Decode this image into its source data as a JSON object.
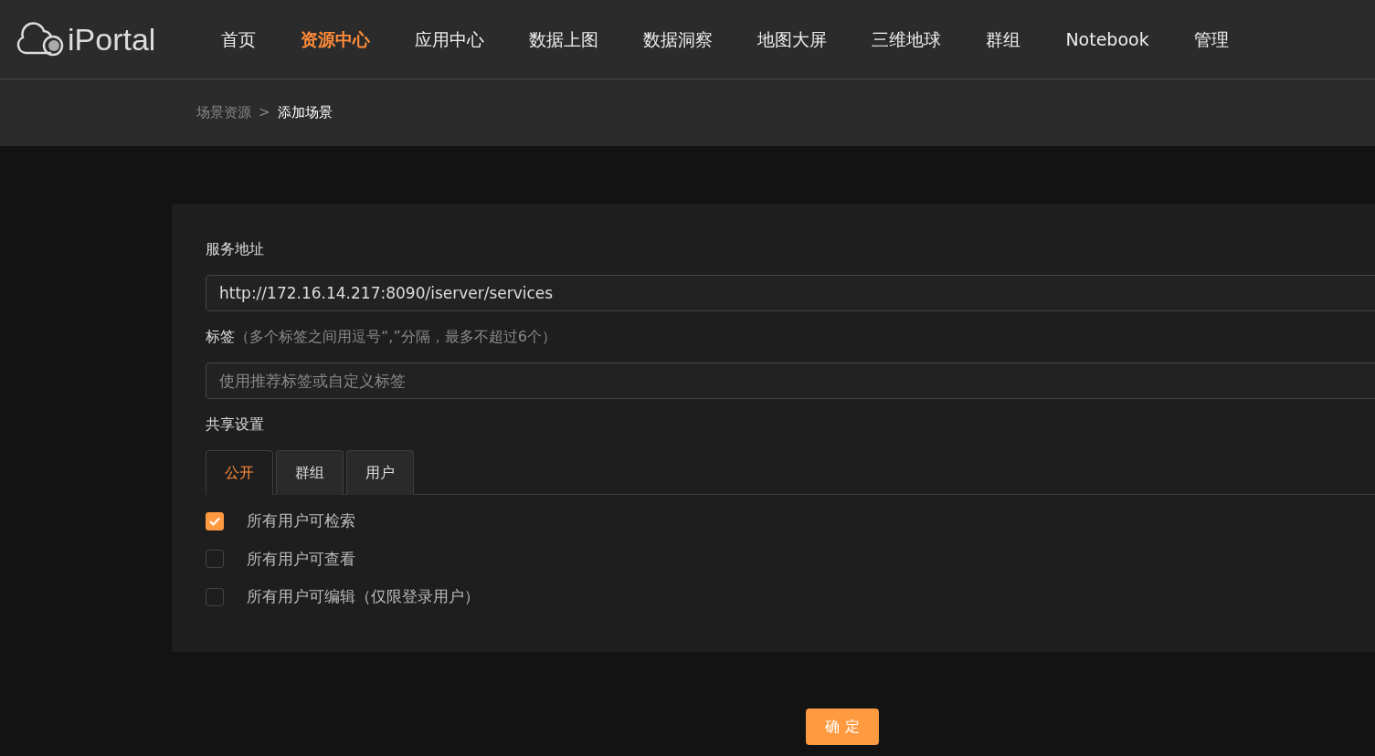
{
  "header": {
    "logo_text": "iPortal",
    "nav": [
      {
        "label": "首页",
        "selected": false
      },
      {
        "label": "资源中心",
        "selected": true
      },
      {
        "label": "应用中心",
        "selected": false
      },
      {
        "label": "数据上图",
        "selected": false
      },
      {
        "label": "数据洞察",
        "selected": false
      },
      {
        "label": "地图大屏",
        "selected": false
      },
      {
        "label": "三维地球",
        "selected": false
      },
      {
        "label": "群组",
        "selected": false
      },
      {
        "label": "Notebook",
        "selected": false
      },
      {
        "label": "管理",
        "selected": false
      }
    ]
  },
  "breadcrumb": {
    "parent": "场景资源",
    "separator": ">",
    "current": "添加场景"
  },
  "form": {
    "service_label": "服务地址",
    "service_value": "http://172.16.14.217:8090/iserver/services",
    "tags_label": "标签",
    "tags_hint": "（多个标签之间用逗号“,”分隔，最多不超过6个）",
    "tags_placeholder": "使用推荐标签或自定义标签",
    "share_label": "共享设置",
    "share_tabs": [
      {
        "label": "公开",
        "selected": true
      },
      {
        "label": "群组",
        "selected": false
      },
      {
        "label": "用户",
        "selected": false
      }
    ],
    "options": [
      {
        "label": "所有用户可检索",
        "checked": true
      },
      {
        "label": "所有用户可查看",
        "checked": false
      },
      {
        "label": "所有用户可编辑（仅限登录用户）",
        "checked": false
      }
    ]
  },
  "submit": "确 定"
}
